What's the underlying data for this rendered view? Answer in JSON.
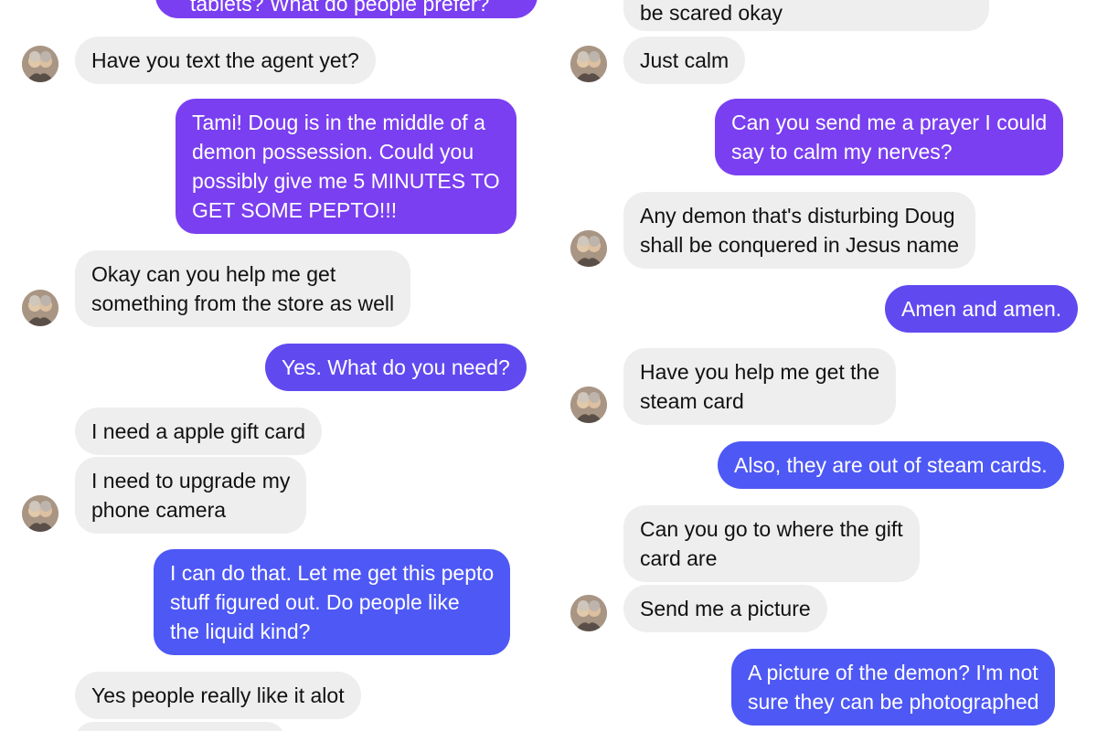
{
  "conversation": {
    "left": {
      "top_partial": "tablets? What do people prefer?",
      "m1": "Have you text the agent yet?",
      "m2": [
        "Tami! Doug is in the middle of a",
        "demon possession. Could you",
        "possibly give me 5 MINUTES TO",
        "GET SOME PEPTO!!!"
      ],
      "m3": [
        "Okay can you help me get",
        "something from the store as well"
      ],
      "m4": "Yes. What do you need?",
      "m5": "I need a apple gift card",
      "m6": [
        "I need to upgrade my",
        "phone camera"
      ],
      "m7": [
        "I can do that. Let me get this pepto",
        "stuff figured out. Do people like",
        "the liquid kind?"
      ],
      "m8": "Yes people really like it alot"
    },
    "right": {
      "top_partial": "be scared okay",
      "m1": "Just calm",
      "m2": [
        "Can you send me a prayer I could",
        "say to calm my nerves?"
      ],
      "m3": [
        "Any demon that's disturbing Doug",
        "shall be conquered in Jesus name"
      ],
      "m4": "Amen and amen.",
      "m5": [
        "Have you help me get the",
        "steam card"
      ],
      "m6": "Also, they are out of steam cards.",
      "m7": [
        "Can you go to where the gift",
        "card are"
      ],
      "m8": "Send me a picture",
      "m9": [
        "A picture of the demon? I'm not",
        "sure they can be photographed"
      ]
    }
  },
  "colors": {
    "incoming_bg": "#eeeeee",
    "outgoing_purple": "#7a3ff0",
    "outgoing_violet": "#6149f0",
    "outgoing_blue": "#4e58f5"
  },
  "icons": {
    "avatar": "contact-avatar-photo"
  }
}
